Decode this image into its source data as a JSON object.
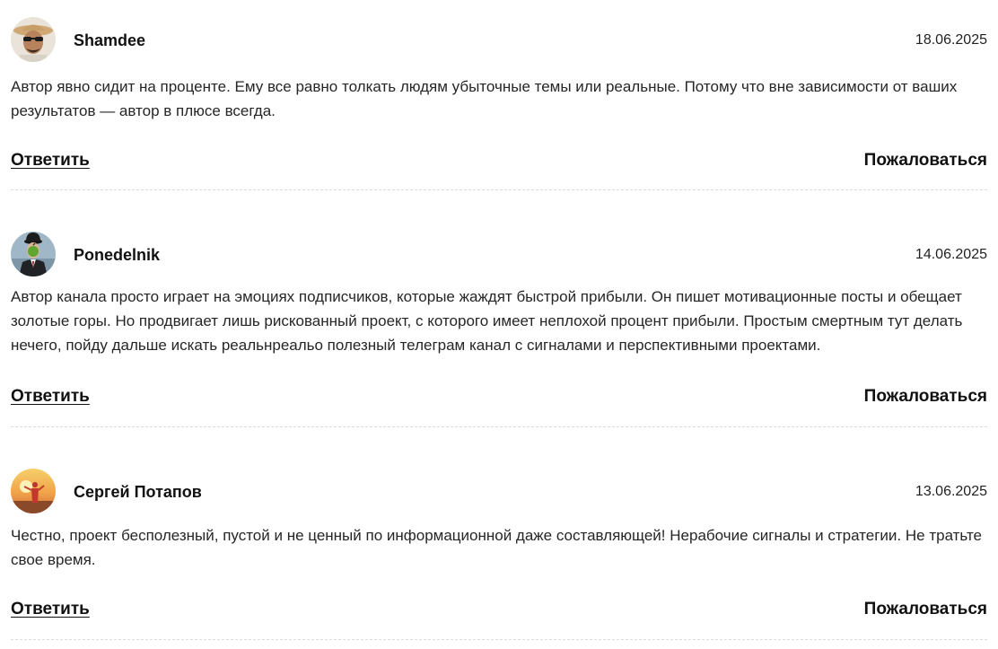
{
  "comments": [
    {
      "author": "Shamdee",
      "date": "18.06.2025",
      "text": "Автор явно сидит на проценте. Ему все равно толкать людям убыточные темы или реальные. Потому что вне зависимости от ваших результатов — автор в плюсе всегда.",
      "reply_label": "Ответить",
      "report_label": "Пожаловаться",
      "avatar_icon": "man-with-sunglasses-and-hat-avatar"
    },
    {
      "author": "Ponedelnik",
      "date": "14.06.2025",
      "text": "Автор канала просто играет на эмоциях подписчиков, которые жаждят быстрой прибыли. Он пишет мотивационные посты и обещает золотые горы. Но продвигает лишь рискованный проект, с которого имеет неплохой процент прибыли. Простым смертным тут делать нечего, пойду дальше искать реальнреальо полезный телеграм канал с сигналами и перспективными проектами.",
      "reply_label": "Ответить",
      "report_label": "Пожаловаться",
      "avatar_icon": "man-in-bowler-hat-with-apple-avatar"
    },
    {
      "author": "Сергей Потапов",
      "date": "13.06.2025",
      "text": "Честно, проект бесполезный, пустой и не ценный по информационной даже составляющей! Нерабочие сигналы и стратегии. Не тратьте свое время.",
      "reply_label": "Ответить",
      "report_label": "Пожаловаться",
      "avatar_icon": "person-at-sunset-avatar"
    }
  ],
  "colors": {
    "text": "#262626",
    "heading": "#111111",
    "divider": "#dcdcdc",
    "background": "#ffffff"
  }
}
